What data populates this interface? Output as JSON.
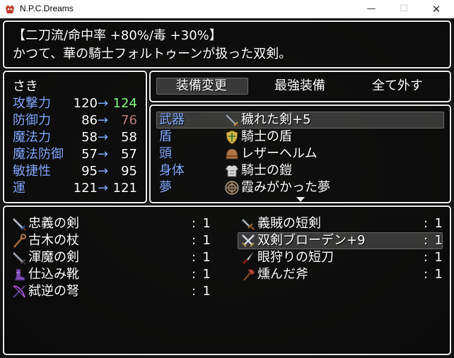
{
  "window": {
    "title": "N.P.C.Dreams",
    "minimize": "—",
    "maximize": "☐",
    "close": "✕"
  },
  "help": {
    "line1": "【二刀流/命中率 +80%/毒 +30%】",
    "line2": "かつて、華の騎士フォルトゥーンが扱った双剣。"
  },
  "actor": {
    "name": "さき",
    "stats": [
      {
        "label": "攻撃力",
        "cur": "120",
        "arrow": "→",
        "new": "124",
        "trend": "up"
      },
      {
        "label": "防御力",
        "cur": "86",
        "arrow": "→",
        "new": "76",
        "trend": "down"
      },
      {
        "label": "魔法力",
        "cur": "58",
        "arrow": "→",
        "new": "58",
        "trend": "same"
      },
      {
        "label": "魔法防御",
        "cur": "57",
        "arrow": "→",
        "new": "57",
        "trend": "same"
      },
      {
        "label": "敏捷性",
        "cur": "95",
        "arrow": "→",
        "new": "95",
        "trend": "same"
      },
      {
        "label": "運",
        "cur": "121",
        "arrow": "→",
        "new": "121",
        "trend": "same"
      }
    ]
  },
  "commands": [
    "装備変更",
    "最強装備",
    "全て外す"
  ],
  "slots": [
    {
      "slot": "武器",
      "item": "穢れた剣+5",
      "icon": "sword-icon"
    },
    {
      "slot": "盾",
      "item": "騎士の盾",
      "icon": "shield-icon"
    },
    {
      "slot": "頭",
      "item": "レザーヘルム",
      "icon": "helmet-icon"
    },
    {
      "slot": "身体",
      "item": "騎士の鎧",
      "icon": "armor-icon"
    },
    {
      "slot": "夢",
      "item": "霞みがかった夢",
      "icon": "dream-orb-icon"
    }
  ],
  "items": [
    {
      "name": "忠義の剣",
      "sep": ":",
      "qty": "1",
      "icon": "sword-icon"
    },
    {
      "name": "義賊の短剣",
      "sep": ":",
      "qty": "1",
      "icon": "dagger-icon"
    },
    {
      "name": "古木の杖",
      "sep": ":",
      "qty": "1",
      "icon": "staff-icon"
    },
    {
      "name": "双剣ブローデン+9",
      "sep": ":",
      "qty": "1",
      "icon": "twin-swords-icon"
    },
    {
      "name": "渾魔の剣",
      "sep": ":",
      "qty": "1",
      "icon": "sword-icon"
    },
    {
      "name": "眼狩りの短刀",
      "sep": ":",
      "qty": "1",
      "icon": "knife-icon"
    },
    {
      "name": "仕込み靴",
      "sep": ":",
      "qty": "1",
      "icon": "boots-icon"
    },
    {
      "name": "燻んだ斧",
      "sep": ":",
      "qty": "1",
      "icon": "axe-icon"
    },
    {
      "name": "弑逆の弩",
      "sep": ":",
      "qty": "1",
      "icon": "crossbow-icon"
    }
  ],
  "colors": {
    "system": "#84aaff",
    "increase": "#80ff80",
    "decrease": "#c08080",
    "text": "#ffffff",
    "frame": "#f2f2f2"
  }
}
